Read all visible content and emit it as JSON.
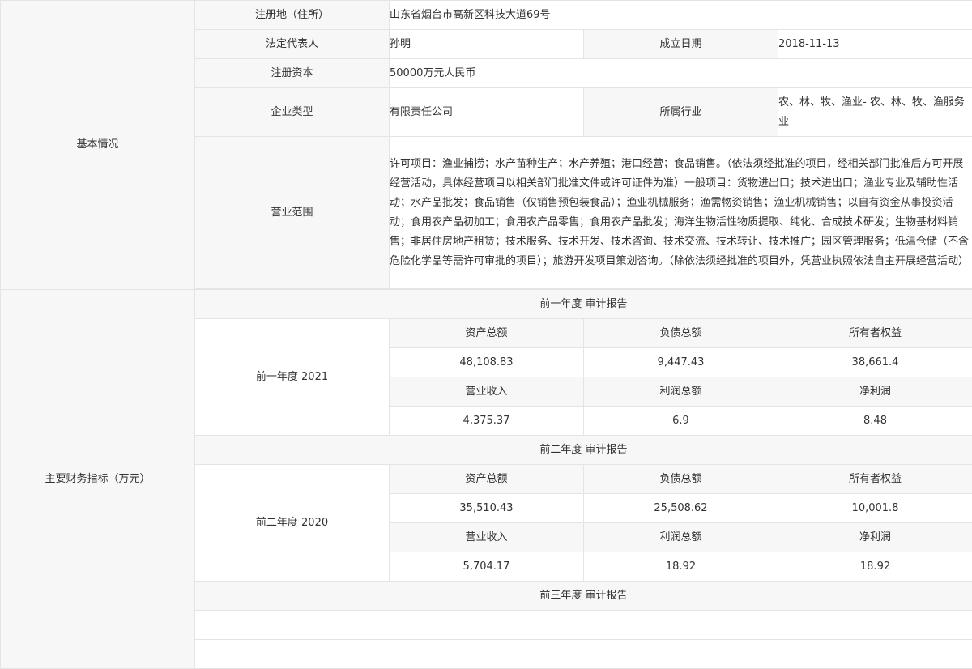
{
  "basic": {
    "section_label": "基本情况",
    "registered_address_label": "注册地（住所）",
    "registered_address": "山东省烟台市高新区科技大道69号",
    "legal_rep_label": "法定代表人",
    "legal_rep": "孙明",
    "established_label": "成立日期",
    "established": "2018-11-13",
    "capital_label": "注册资本",
    "capital": "50000万元人民币",
    "type_label": "企业类型",
    "type": "有限责任公司",
    "industry_label": "所属行业",
    "industry": "农、林、牧、渔业- 农、林、牧、渔服务业",
    "scope_label": "营业范围",
    "scope": "许可项目：渔业捕捞；水产苗种生产；水产养殖；港口经营；食品销售。（依法须经批准的项目，经相关部门批准后方可开展经营活动，具体经营项目以相关部门批准文件或许可证件为准）一般项目：货物进出口；技术进出口；渔业专业及辅助性活动；水产品批发；食品销售（仅销售预包装食品）；渔业机械服务；渔需物资销售；渔业机械销售；以自有资金从事投资活动；食用农产品初加工；食用农产品零售；食用农产品批发；海洋生物活性物质提取、纯化、合成技术研发；生物基材料销售；非居住房地产租赁；技术服务、技术开发、技术咨询、技术交流、技术转让、技术推广；园区管理服务；低温仓储（不含危险化学品等需许可审批的项目）；旅游开发项目策划咨询。（除依法须经批准的项目外，凭营业执照依法自主开展经营活动）"
  },
  "finance": {
    "section_label": "主要财务指标（万元）",
    "years": [
      {
        "header": "前一年度 审计报告",
        "label": "前一年度 2021",
        "assets_label": "资产总额",
        "liabilities_label": "负债总额",
        "equity_label": "所有者权益",
        "assets": "48,108.83",
        "liabilities": "9,447.43",
        "equity": "38,661.4",
        "revenue_label": "营业收入",
        "profit_label": "利润总额",
        "net_profit_label": "净利润",
        "revenue": "4,375.37",
        "profit": "6.9",
        "net_profit": "8.48"
      },
      {
        "header": "前二年度 审计报告",
        "label": "前二年度 2020",
        "assets_label": "资产总额",
        "liabilities_label": "负债总额",
        "equity_label": "所有者权益",
        "assets": "35,510.43",
        "liabilities": "25,508.62",
        "equity": "10,001.8",
        "revenue_label": "营业收入",
        "profit_label": "利润总额",
        "net_profit_label": "净利润",
        "revenue": "5,704.17",
        "profit": "18.92",
        "net_profit": "18.92"
      },
      {
        "header": "前三年度 审计报告"
      }
    ]
  }
}
